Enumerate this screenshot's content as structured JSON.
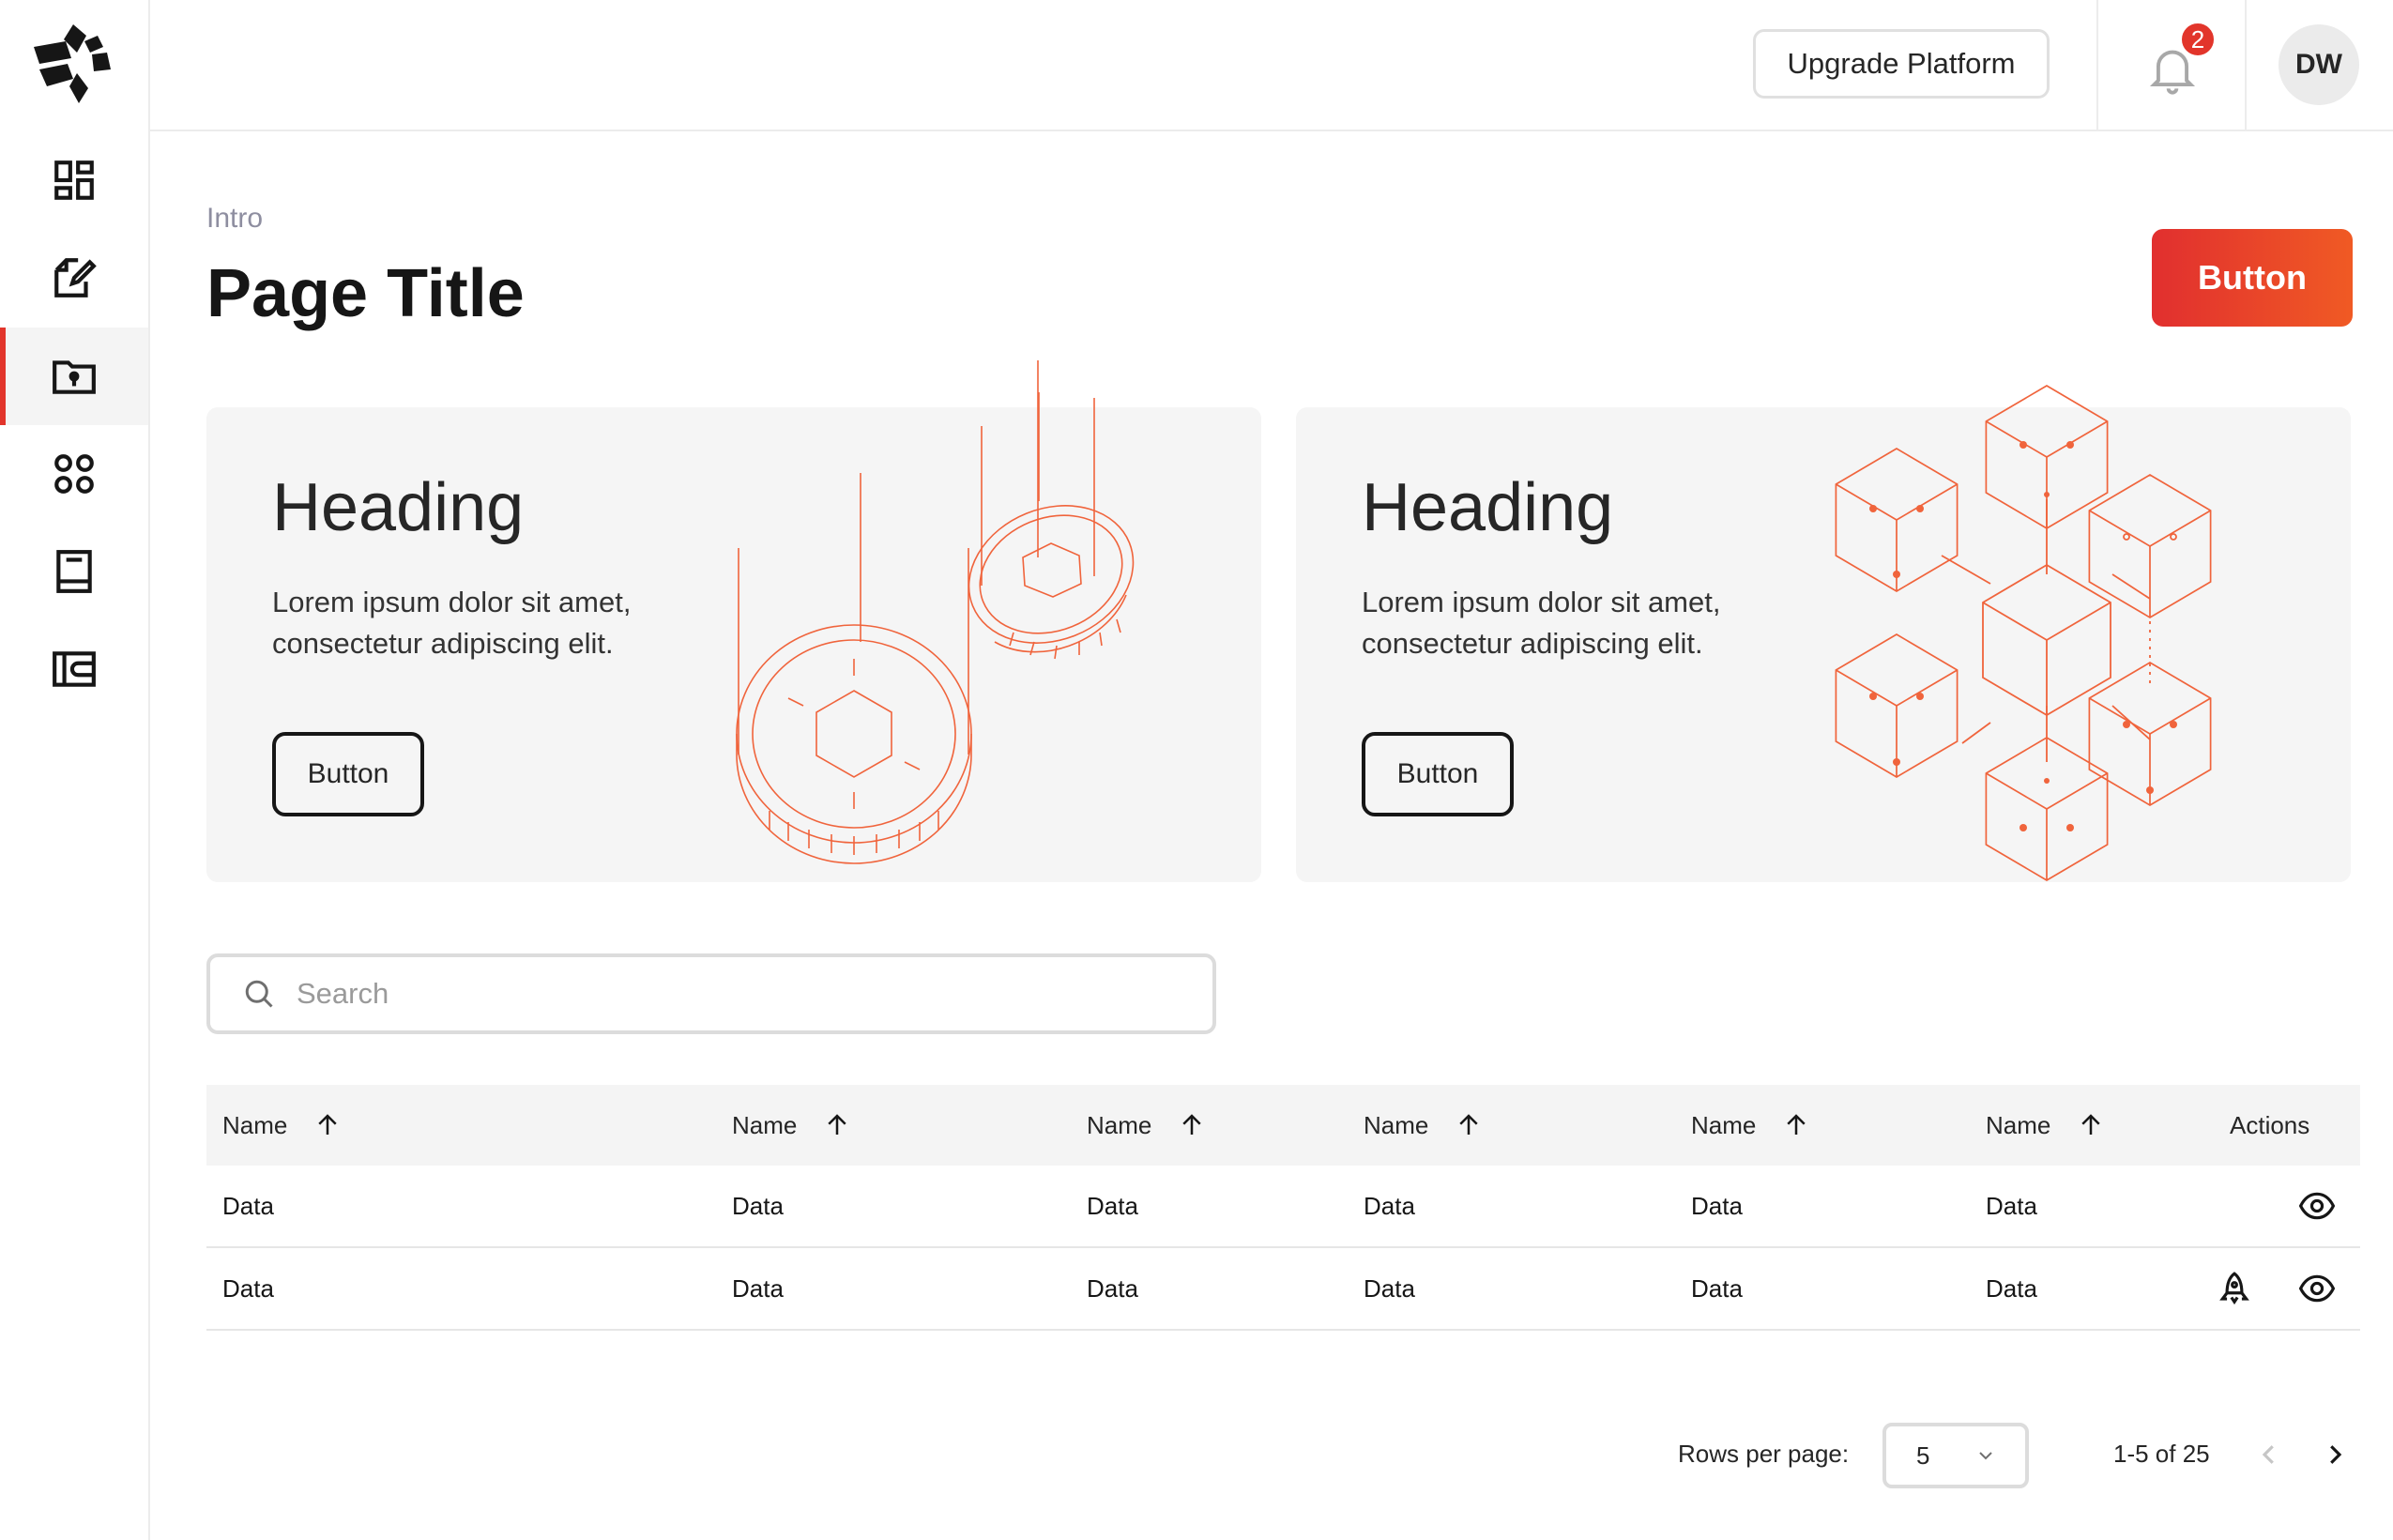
{
  "header": {
    "upgrade_label": "Upgrade Platform",
    "notification_count": "2",
    "avatar_initials": "DW"
  },
  "sidebar": {
    "items": [
      {
        "icon": "dashboard-icon",
        "active": false
      },
      {
        "icon": "edit-document-icon",
        "active": false
      },
      {
        "icon": "secure-folder-icon",
        "active": true
      },
      {
        "icon": "apps-grid-icon",
        "active": false
      },
      {
        "icon": "book-icon",
        "active": false
      },
      {
        "icon": "wallet-icon",
        "active": false
      }
    ]
  },
  "page": {
    "intro": "Intro",
    "title": "Page Title",
    "primary_button": "Button"
  },
  "cards": [
    {
      "heading": "Heading",
      "text": "Lorem ipsum dolor sit amet, consectetur adipiscing elit.",
      "button": "Button",
      "illustration": "falling-coins-illustration"
    },
    {
      "heading": "Heading",
      "text": "Lorem ipsum dolor sit amet, consectetur adipiscing elit.",
      "button": "Button",
      "illustration": "blockchain-cubes-illustration"
    }
  ],
  "search": {
    "placeholder": "Search",
    "value": ""
  },
  "table": {
    "columns": [
      "Name",
      "Name",
      "Name",
      "Name",
      "Name",
      "Name"
    ],
    "actions_header": "Actions",
    "rows": [
      {
        "cells": [
          "Data",
          "Data",
          "Data",
          "Data",
          "Data",
          "Data"
        ],
        "actions": [
          "eye-icon"
        ]
      },
      {
        "cells": [
          "Data",
          "Data",
          "Data",
          "Data",
          "Data",
          "Data"
        ],
        "actions": [
          "rocket-icon",
          "eye-icon"
        ]
      }
    ]
  },
  "pagination": {
    "rows_label": "Rows per page:",
    "rows_value": "5",
    "range": "1-5 of 25"
  },
  "colors": {
    "accent": "#e2352b",
    "accent_gradient_end": "#f05a24",
    "illustration": "#f0643c"
  }
}
